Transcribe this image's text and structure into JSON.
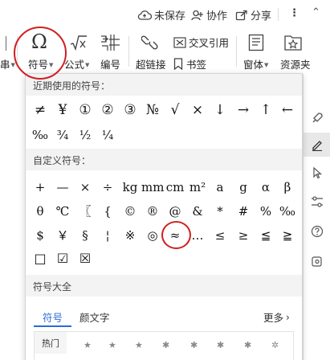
{
  "topbar": {
    "unsaved_label": "未保存",
    "collab_label": "协作",
    "share_label": "分享",
    "more_label": "⋮",
    "collapse_label": "⌃"
  },
  "ribbon": {
    "left_cut_label": "串",
    "symbol_label": "符号",
    "formula_label": "公式",
    "numbering_label": "编号",
    "hyperlink_label": "超链接",
    "crossref_label": "交叉引用",
    "bookmark_label": "书签",
    "window_label": "窗体",
    "resource_label": "资源夹"
  },
  "panel": {
    "recent_header": "近期使用的符号：",
    "recent_row1": [
      "≠",
      "¥",
      "①",
      "②",
      "③",
      "№",
      "√",
      "×",
      "↓",
      "→",
      "↑",
      "←"
    ],
    "recent_row2": [
      "‰",
      "¾",
      "½",
      "¼"
    ],
    "custom_header": "自定义符号：",
    "custom_row1": [
      "+",
      "—",
      "×",
      "÷",
      "kg",
      "mm",
      "cm",
      "m²",
      "a",
      "g",
      "α",
      "β"
    ],
    "custom_row2": [
      "θ",
      "℃",
      "〖",
      "{",
      "©",
      "®",
      "@",
      "&",
      "*",
      "#",
      "%",
      "‰"
    ],
    "custom_row3": [
      "$",
      "￥",
      "§",
      "¦",
      "※",
      "◎",
      "≈",
      "…",
      "≤",
      "≥",
      "≦",
      "≧"
    ],
    "custom_row4": [
      "□",
      "☑",
      "☒"
    ],
    "all_header": "符号大全",
    "tab_symbol": "符号",
    "tab_emoticon": "颜文字",
    "more_label": "更多",
    "hot_label": "热门",
    "stars": [
      "★",
      "★",
      "★",
      "✱",
      "✱",
      "✱",
      "✱",
      "✲"
    ]
  },
  "colors": {
    "accent": "#2b6bd8",
    "annotation": "#d02020",
    "section_bg": "#f3f3f3"
  }
}
